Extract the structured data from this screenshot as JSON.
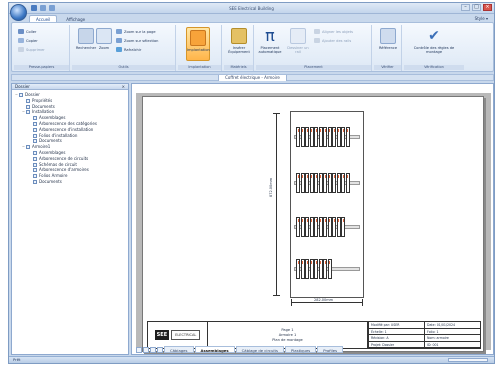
{
  "window": {
    "title": "SEE Electrical Building",
    "controls": [
      "–",
      "□",
      "×"
    ]
  },
  "ribbon_tabs": [
    {
      "label": "Accueil",
      "active": true
    },
    {
      "label": "Affichage",
      "active": false
    }
  ],
  "style_menu": "Style ▾",
  "ribbon": {
    "clipboard": {
      "label": "Presse-papiers",
      "buttons": [
        "Coller",
        "Copier",
        "Supprimer"
      ]
    },
    "find": {
      "label": "Outils",
      "buttons": [
        "Rechercher",
        "Zoom",
        "Dernier",
        "Zoom sur la page",
        "Zoom sur sélection",
        "Rafraîchir"
      ]
    },
    "placement": {
      "label": "Implantation",
      "highlighted": "Implantation"
    },
    "equipment": {
      "label": "Matériels",
      "buttons": [
        "Insérer Équipement"
      ]
    },
    "auto": {
      "label": "Placement",
      "buttons": [
        "Placement automatique",
        "Dessiner un rail",
        "Aligner les objets",
        "Ajouter des rails"
      ]
    },
    "print": {
      "label": "Vérifier",
      "buttons": [
        "Référence"
      ]
    },
    "check": {
      "label": "Vérification",
      "buttons": [
        "Contrôle des règles de montage"
      ]
    }
  },
  "document_tab": "Coffret électrique - Armoire",
  "sidebar": {
    "title": "Dossier",
    "tree": [
      {
        "label": "Dossier",
        "level": 0,
        "toggle": "−"
      },
      {
        "label": "Propriétés",
        "level": 1,
        "toggle": ""
      },
      {
        "label": "Documents",
        "level": 1,
        "toggle": ""
      },
      {
        "label": "Installation",
        "level": 1,
        "toggle": "−"
      },
      {
        "label": "Assemblages",
        "level": 2,
        "toggle": ""
      },
      {
        "label": "Arborescence des catégories",
        "level": 2,
        "toggle": ""
      },
      {
        "label": "Arborescence d'installation",
        "level": 2,
        "toggle": ""
      },
      {
        "label": "Folios d'installation",
        "level": 2,
        "toggle": ""
      },
      {
        "label": "Documents",
        "level": 2,
        "toggle": ""
      },
      {
        "label": "Armoire1",
        "level": 1,
        "toggle": "−"
      },
      {
        "label": "Assemblages",
        "level": 2,
        "toggle": ""
      },
      {
        "label": "Arborescence de circuits",
        "level": 2,
        "toggle": ""
      },
      {
        "label": "Schémas de circuit",
        "level": 2,
        "toggle": ""
      },
      {
        "label": "Arborescence d'armoires",
        "level": 2,
        "toggle": ""
      },
      {
        "label": "Folios Armoire",
        "level": 2,
        "toggle": ""
      },
      {
        "label": "Documents",
        "level": 2,
        "toggle": ""
      }
    ]
  },
  "drawing": {
    "dim_vertical": "872.00mm",
    "dim_horizontal": "282.00mm",
    "rails": [
      {
        "modules": 12
      },
      {
        "modules": 12
      },
      {
        "modules": 11
      },
      {
        "modules": 8
      }
    ],
    "title_block": {
      "logo_mark": "SEE",
      "logo_text": "ELECTRICAL",
      "center": [
        "Page 1",
        "Armoire 1",
        "Plan de montage"
      ],
      "right": [
        "Modifié par: USER",
        "Date: 01/01/2024",
        "Échelle: 1",
        "Folio: 1",
        "Révision: A",
        "Nom: armoire",
        "Projet: Dossier",
        "ID: 001"
      ]
    }
  },
  "bottom_tabs": [
    {
      "label": "Câblages",
      "active": false
    },
    {
      "label": "Assemblages",
      "active": true
    },
    {
      "label": "Câblage de circuits",
      "active": false
    },
    {
      "label": "Plastiques",
      "active": false
    },
    {
      "label": "Profiles",
      "active": false
    }
  ],
  "status": "Prêt",
  "colors": {
    "accent": "#15428b",
    "module_top": "#e6673d",
    "highlight": "#ffb54a"
  }
}
